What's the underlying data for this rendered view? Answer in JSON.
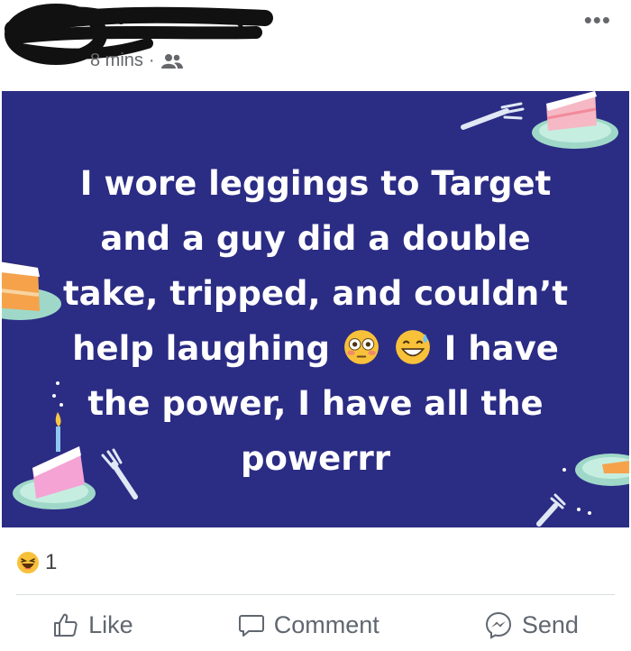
{
  "header": {
    "time": "8 mins",
    "separator": "·",
    "audience_icon": "friends-icon",
    "more_label": "•••"
  },
  "post": {
    "background_color": "#2b2c84",
    "lines": {
      "line1": "I wore leggings to Target",
      "line2": "and a guy did a double",
      "line3": "take, tripped, and couldn’t",
      "line4_a": "help laughing",
      "line4_b": "I have",
      "line5": "the power, I have all the",
      "line6": "powerrr"
    },
    "emojis": [
      "flushed-face-emoji",
      "grinning-sweat-emoji"
    ]
  },
  "reactions": {
    "icon": "haha-reaction-icon",
    "count": "1"
  },
  "actions": {
    "like": "Like",
    "comment": "Comment",
    "send": "Send"
  }
}
